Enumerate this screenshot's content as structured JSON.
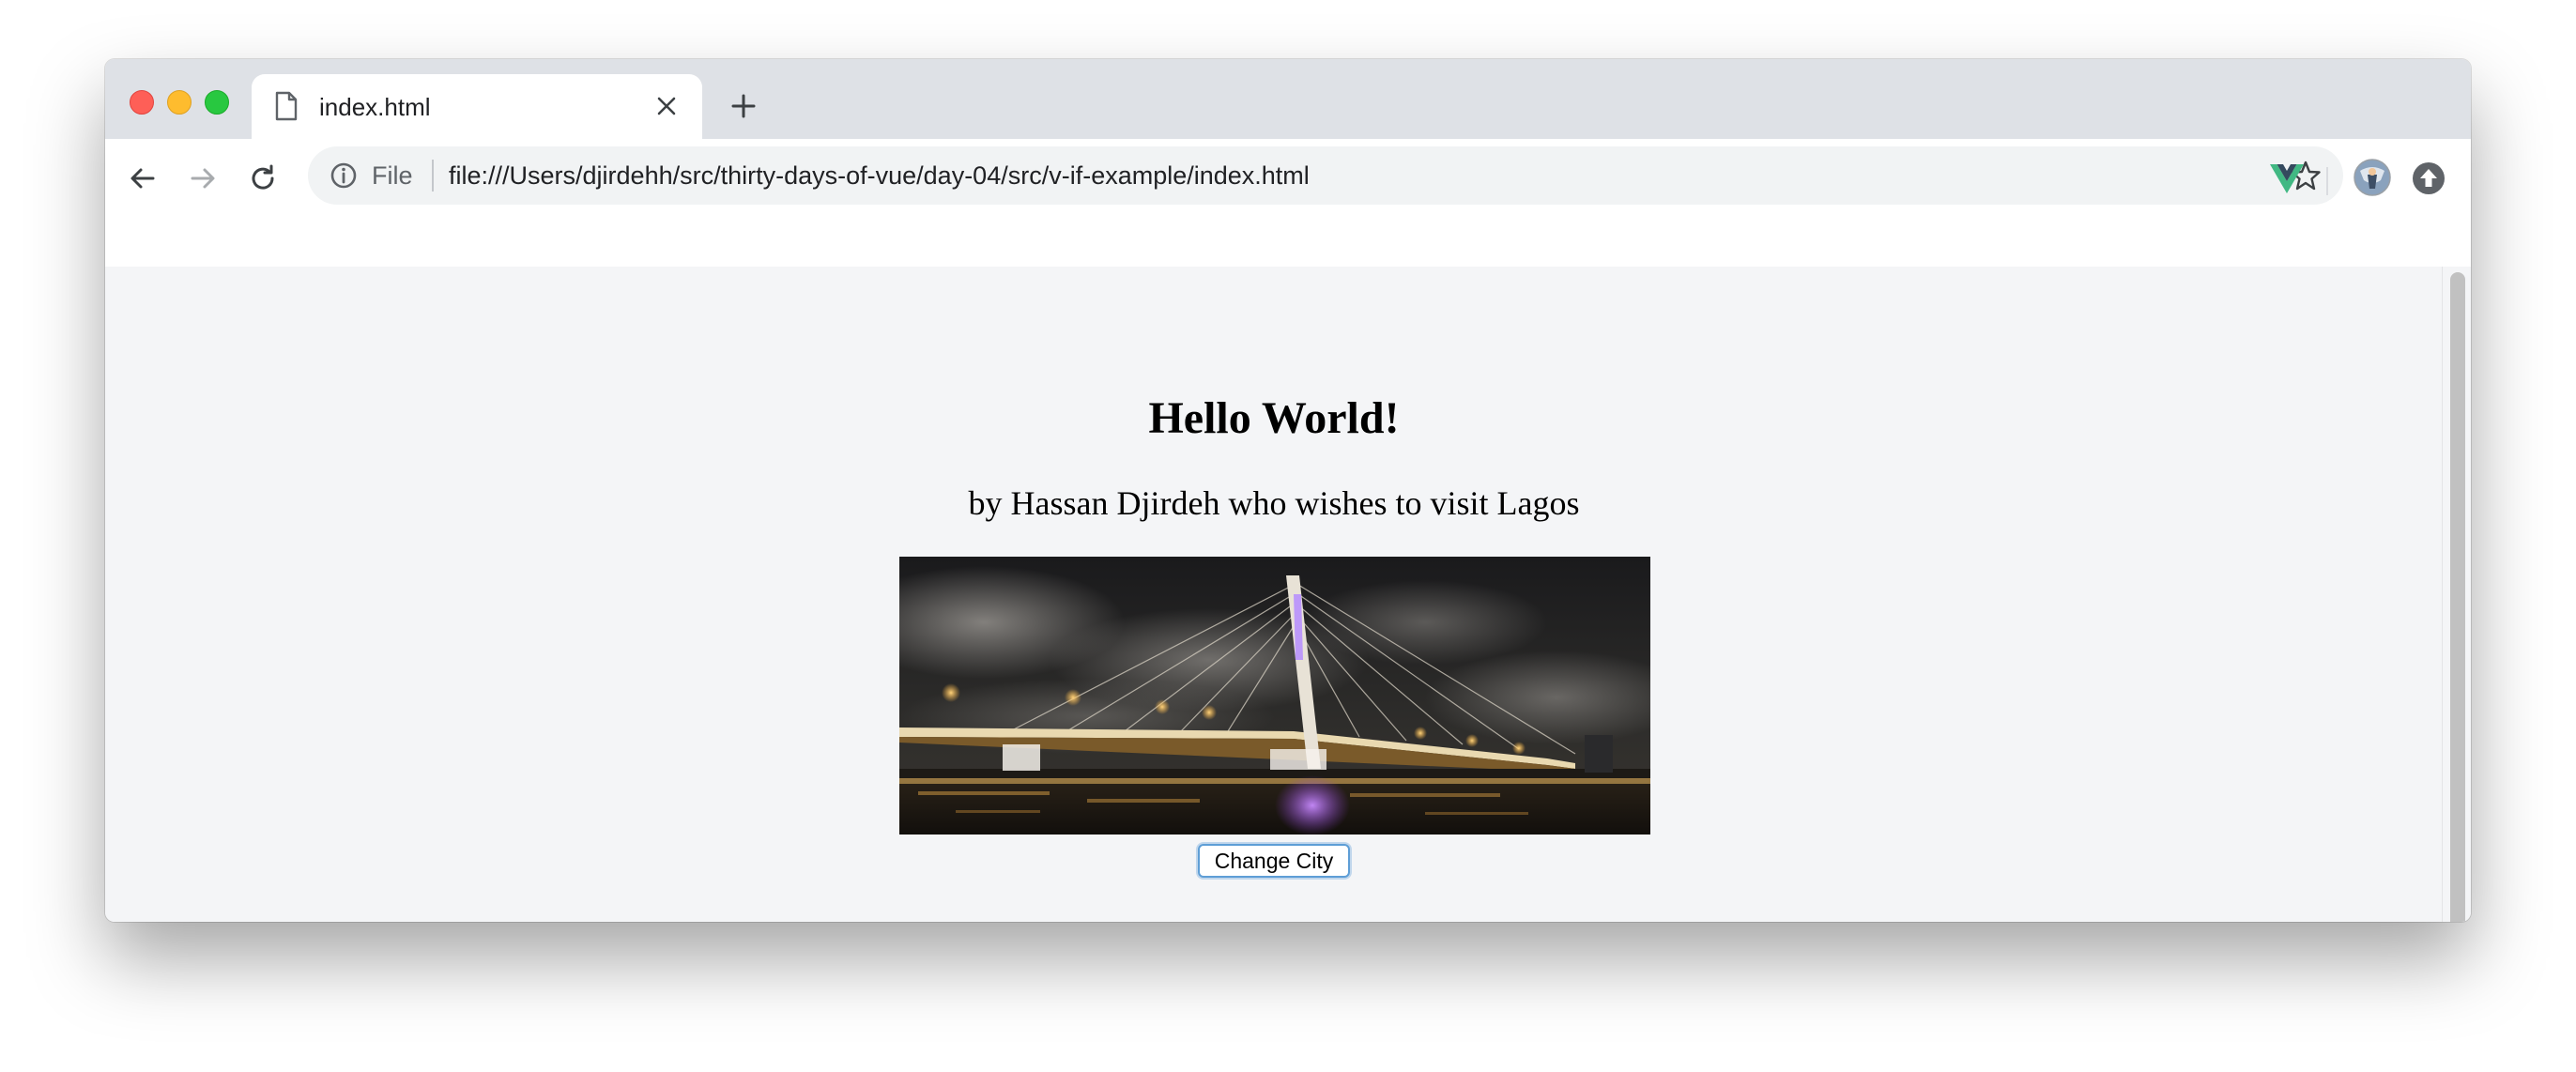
{
  "browser": {
    "tab": {
      "title": "index.html",
      "icon": "document-icon"
    },
    "omnibox": {
      "scheme_label": "File",
      "url": "file:///Users/djirdehh/src/thirty-days-of-vue/day-04/src/v-if-example/index.html"
    },
    "icons": {
      "back": "arrow-left-icon",
      "forward": "arrow-right-icon",
      "reload": "reload-icon",
      "info": "info-icon",
      "bookmark": "star-icon",
      "vue_devtools": "vue-logo-icon",
      "profile": "avatar",
      "update": "arrow-up-circle-icon"
    },
    "colors": {
      "vue_green": "#41b883",
      "vue_dark": "#34495e"
    }
  },
  "page": {
    "title": "Hello World!",
    "byline": "by Hassan Djirdeh who wishes to visit Lagos",
    "button_label": "Change City"
  }
}
